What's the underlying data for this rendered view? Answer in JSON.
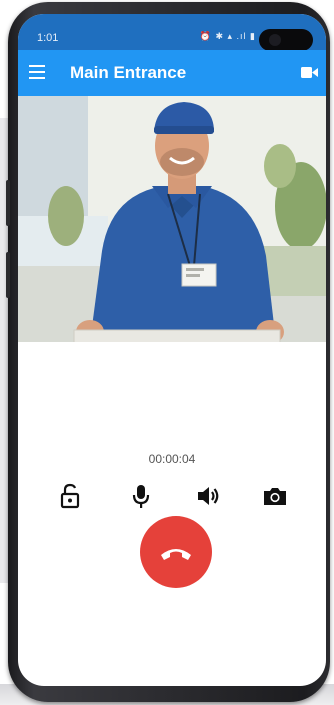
{
  "status_bar": {
    "time": "1:01",
    "icons": "⏰ ✱ ▴ .ıl ▮"
  },
  "app_bar": {
    "title": "Main Entrance",
    "menu_icon": "hamburger-menu-icon",
    "action_icon": "video-camera-icon"
  },
  "video": {
    "subject": "delivery-person-camera-feed"
  },
  "call": {
    "duration": "00:00:04"
  },
  "controls": [
    {
      "icon": "unlock-icon"
    },
    {
      "icon": "microphone-icon"
    },
    {
      "icon": "speaker-icon"
    },
    {
      "icon": "camera-icon"
    }
  ],
  "hangup": {
    "icon": "phone-hangup-icon",
    "color": "#e5413a"
  },
  "colors": {
    "status_bar": "#1f6fbf",
    "app_bar": "#2196f3",
    "icon": "#111111"
  }
}
